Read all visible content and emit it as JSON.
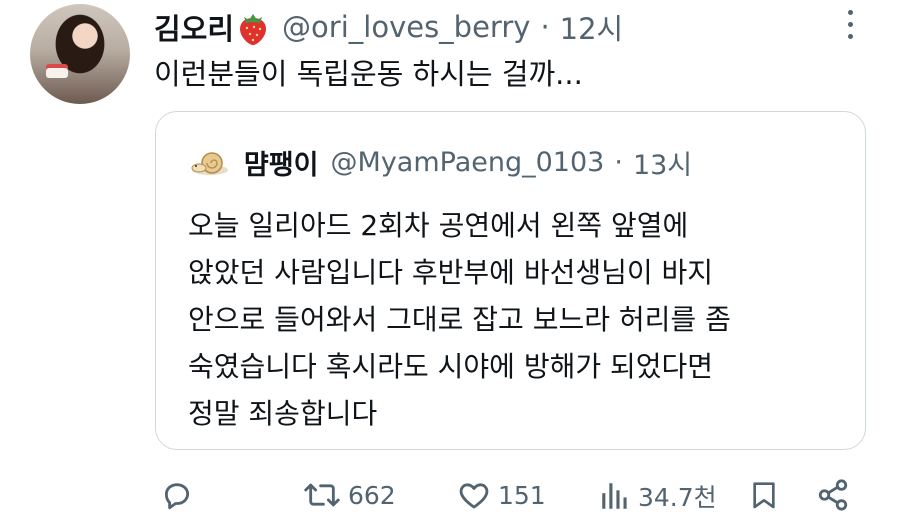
{
  "tweet": {
    "author_name": "김오리",
    "author_handle": "@ori_loves_berry",
    "separator": "·",
    "time": "12시",
    "text": "이런분들이 독립운동 하시는 걸까..."
  },
  "quoted_tweet": {
    "author_name": "먐팽이",
    "author_handle": "@MyamPaeng_0103",
    "separator": "·",
    "time": "13시",
    "lines": [
      "오늘 일리아드 2회차 공연에서 왼쪽 앞열에",
      "앉았던 사람입니다 후반부에 바선생님이 바지",
      "안으로 들어와서 그대로 잡고 보느라 허리를 좀",
      "숙였습니다 혹시라도 시야에 방해가 되었다면",
      "정말 죄송합니다"
    ]
  },
  "actions": {
    "retweets": "662",
    "likes": "151",
    "views": "34.7천"
  },
  "icons": {
    "reply": "reply-icon",
    "retweet": "retweet-icon",
    "like": "heart-icon",
    "views": "views-icon",
    "bookmark": "bookmark-icon",
    "share": "share-icon",
    "more": "more-icon",
    "emoji": "strawberry-emoji"
  },
  "colors": {
    "text": "#0f1419",
    "secondary": "#536471",
    "border": "#cfd9de",
    "retweet_icon": "#536471"
  }
}
